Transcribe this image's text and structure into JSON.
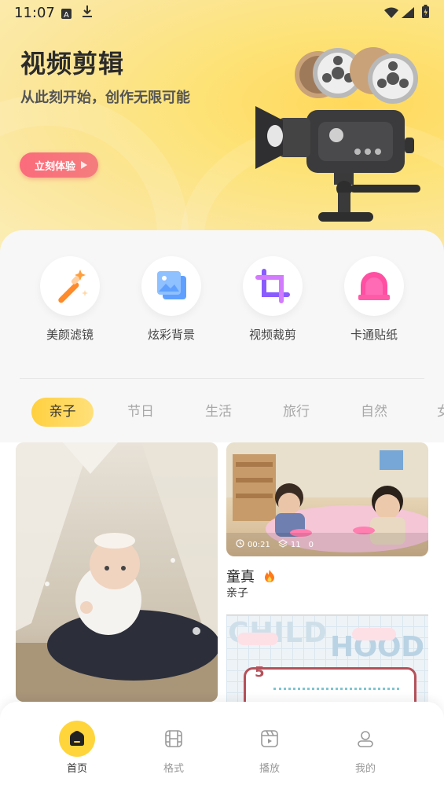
{
  "status_bar": {
    "time": "11:07"
  },
  "hero": {
    "title": "视频剪辑",
    "subtitle": "从此刻开始，创作无限可能",
    "cta_label": "立刻体验"
  },
  "tools": [
    {
      "label": "美颜滤镜",
      "icon": "magic-wand-icon"
    },
    {
      "label": "炫彩背景",
      "icon": "picture-icon"
    },
    {
      "label": "视频裁剪",
      "icon": "crop-icon"
    },
    {
      "label": "卡通贴纸",
      "icon": "sticker-icon"
    }
  ],
  "category_tabs": [
    "亲子",
    "节日",
    "生活",
    "旅行",
    "自然",
    "女"
  ],
  "active_tab": "亲子",
  "feed": {
    "card2": {
      "duration": "00:21",
      "layers": "11",
      "count": "0",
      "title": "童真",
      "category": "亲子"
    },
    "card3_text": "CHILD HOOD",
    "card3_number": "5"
  },
  "bottom_nav": [
    {
      "label": "首页",
      "icon": "home-icon"
    },
    {
      "label": "格式",
      "icon": "film-icon"
    },
    {
      "label": "播放",
      "icon": "play-icon"
    },
    {
      "label": "我的",
      "icon": "user-icon"
    }
  ],
  "colors": {
    "accent_yellow": "#ffd53b",
    "cta_pink": "#fb6b7c",
    "hero_bg": "#fde37a"
  }
}
